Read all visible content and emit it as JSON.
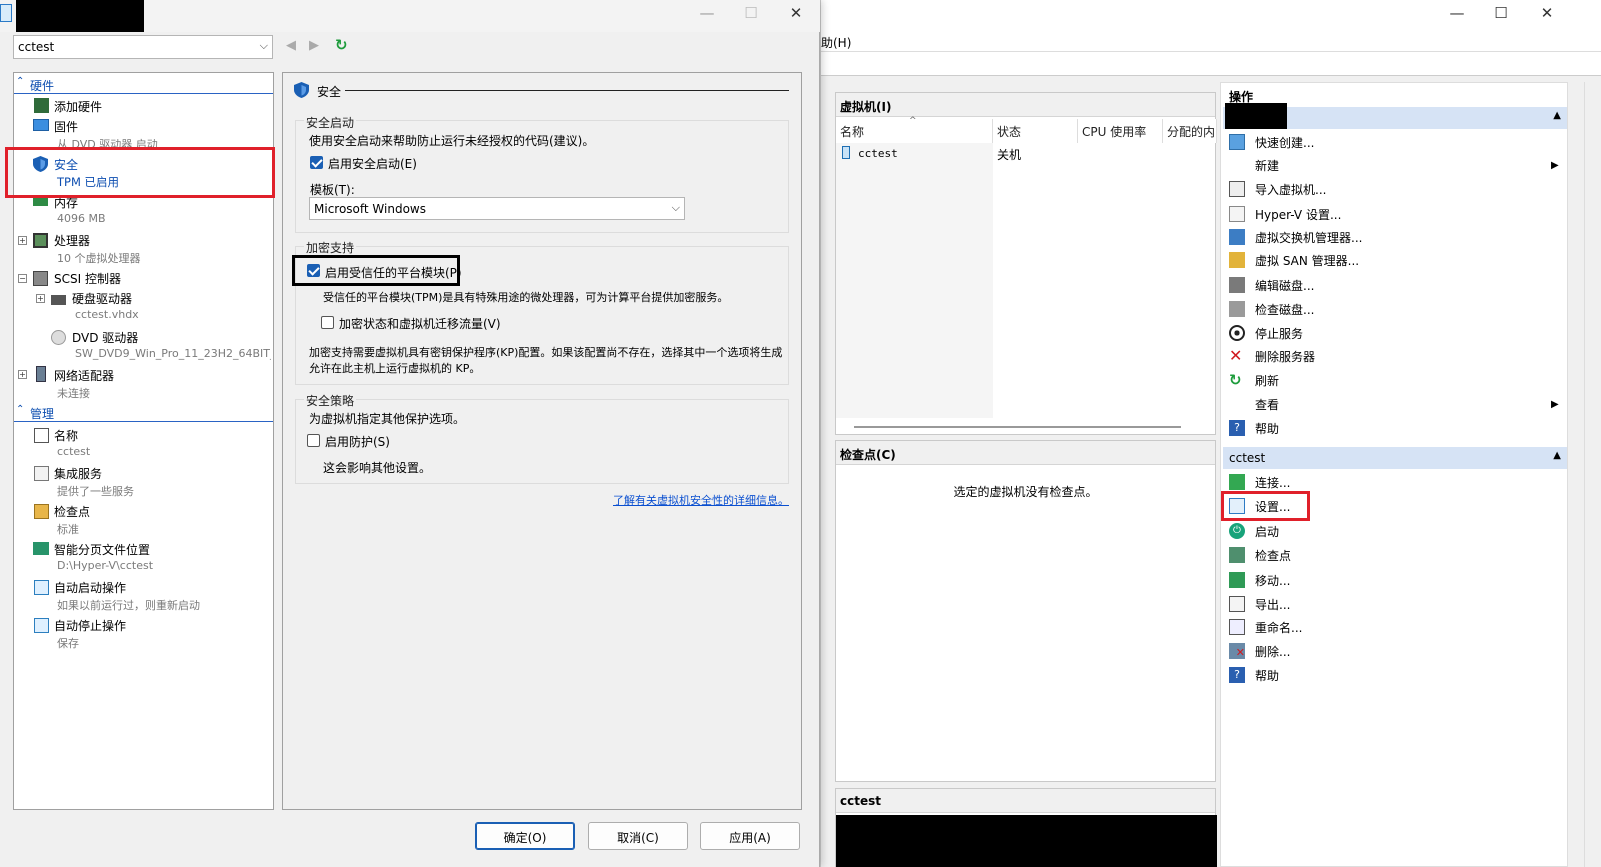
{
  "manager": {
    "menu_help": "助(H)",
    "vm_panel": {
      "title": "虚拟机(I)",
      "columns": [
        "名称",
        "状态",
        "CPU 使用率",
        "分配的内"
      ],
      "rows": [
        {
          "name": "cctest",
          "state": "关机"
        }
      ]
    },
    "checkpoint_panel": {
      "title": "检查点(C)",
      "empty_text": "选定的虚拟机没有检查点。"
    },
    "details_panel": {
      "title": "cctest"
    },
    "actions": {
      "title": "操作",
      "server_items": [
        "快速创建...",
        "新建",
        "导入虚拟机...",
        "Hyper-V 设置...",
        "虚拟交换机管理器...",
        "虚拟 SAN 管理器...",
        "编辑磁盘...",
        "检查磁盘...",
        "停止服务",
        "删除服务器",
        "刷新",
        "查看",
        "帮助"
      ],
      "vm_section": "cctest",
      "vm_items": [
        "连接...",
        "设置...",
        "启动",
        "检查点",
        "移动...",
        "导出...",
        "重命名...",
        "删除...",
        "帮助"
      ]
    }
  },
  "dialog": {
    "vm_select": "cctest",
    "tree": {
      "hardware_header": "硬件",
      "add_hardware": "添加硬件",
      "firmware": "固件",
      "firmware_sub": "从 DVD 驱动器 启动",
      "security": "安全",
      "security_sub": "TPM 已启用",
      "memory": "内存",
      "memory_sub": "4096 MB",
      "processor": "处理器",
      "processor_sub": "10 个虚拟处理器",
      "scsi": "SCSI 控制器",
      "hdd": "硬盘驱动器",
      "hdd_sub": "cctest.vhdx",
      "dvd": "DVD 驱动器",
      "dvd_sub": "SW_DVD9_Win_Pro_11_23H2_64BIT_...",
      "network": "网络适配器",
      "network_sub": "未连接",
      "management_header": "管理",
      "name": "名称",
      "name_sub": "cctest",
      "integration": "集成服务",
      "integration_sub": "提供了一些服务",
      "checkpoints": "检查点",
      "checkpoints_sub": "标准",
      "paging": "智能分页文件位置",
      "paging_sub": "D:\\Hyper-V\\cctest",
      "autostart": "自动启动操作",
      "autostart_sub": "如果以前运行过，则重新启动",
      "autostop": "自动停止操作",
      "autostop_sub": "保存"
    },
    "security": {
      "heading": "安全",
      "secure_boot_group": "安全启动",
      "secure_boot_desc": "使用安全启动来帮助防止运行未经授权的代码(建议)。",
      "enable_secure_boot": "启用安全启动(E)",
      "enable_secure_boot_checked": true,
      "template_label": "模板(T):",
      "template_value": "Microsoft Windows",
      "encryption_group": "加密支持",
      "enable_tpm": "启用受信任的平台模块(P)",
      "enable_tpm_checked": true,
      "tpm_desc": "受信任的平台模块(TPM)是具有特殊用途的微处理器，可为计算平台提供加密服务。",
      "encrypt_traffic": "加密状态和虚拟机迁移流量(V)",
      "encrypt_traffic_checked": false,
      "kp_desc_1": "加密支持需要虚拟机具有密钥保护程序(KP)配置。如果该配置尚不存在，选择其中一个选项将生成",
      "kp_desc_2": "允许在此主机上运行虚拟机的 KP。",
      "policy_group": "安全策略",
      "policy_desc": "为虚拟机指定其他保护选项。",
      "enable_shielding": "启用防护(S)",
      "enable_shielding_checked": false,
      "shielding_note": "这会影响其他设置。",
      "learn_more": "了解有关虚拟机安全性的详细信息。"
    },
    "buttons": {
      "ok": "确定(O)",
      "cancel": "取消(C)",
      "apply": "应用(A)"
    }
  },
  "colors": {
    "accent": "#1a5fb4",
    "highlight": "#e0202a",
    "section_bg": "#d6e3f5"
  }
}
